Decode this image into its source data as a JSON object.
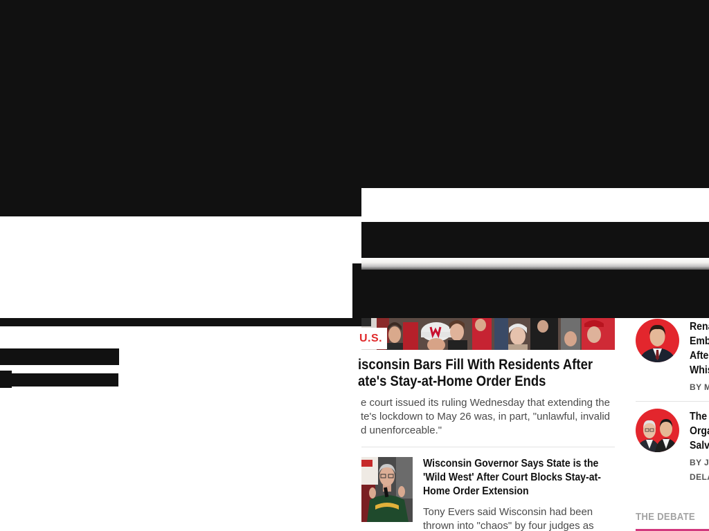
{
  "colors": {
    "redaction": "#111111",
    "category_red": "#e02a2b",
    "headline": "#111111",
    "summary": "#4a4a4a",
    "byline": "#555555",
    "section_heading": "#a3a3a3",
    "section_accent": "#d2387e",
    "divider": "#e2e2e2"
  },
  "main": {
    "featured": {
      "image": "crowd-photo",
      "category": "U.S.",
      "headline_lines": [
        "isconsin Bars Fill With Residents After",
        "ate's Stay-at-Home Order Ends"
      ],
      "summary_lines": [
        "e court issued its ruling Wednesday that extending the",
        "te's lockdown to May 26 was, in part, \"unlawful, invalid",
        "d unenforceable.\""
      ]
    },
    "secondary": {
      "image": "governor-photo",
      "headline_lines": [
        "Wisconsin Governor Says State is the",
        "'Wild West' After Court Blocks Stay-at-",
        "Home Order Extension"
      ],
      "summary_lines": [
        "Tony Evers said Wisconsin had been",
        "thrown into \"chaos\" by four judges as"
      ]
    }
  },
  "sidebar": {
    "items": [
      {
        "avatar": "senator-avatar",
        "headline_lines": [
          "Rena",
          "Emb",
          "Afte",
          "Whis"
        ],
        "byline_lines": [
          "BY M"
        ]
      },
      {
        "avatar": "panel-avatar",
        "headline_lines": [
          "The",
          "Orga",
          "Salv"
        ],
        "byline_lines": [
          "BY JO",
          "DELA"
        ]
      }
    ],
    "section_heading": "THE DEBATE"
  }
}
